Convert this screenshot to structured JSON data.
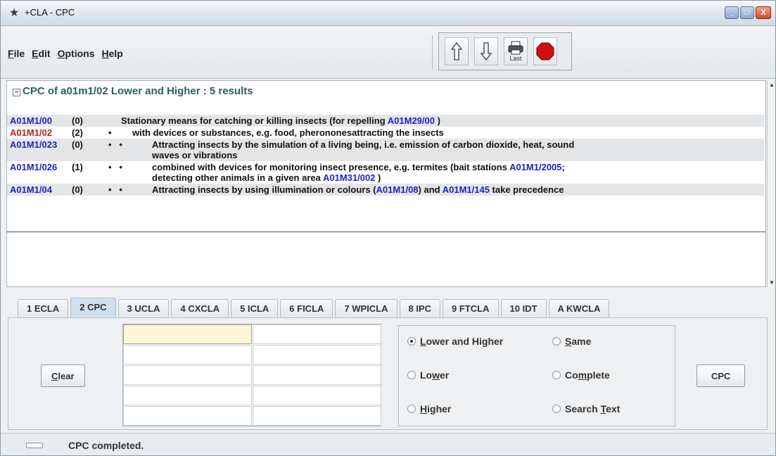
{
  "window": {
    "title": "+CLA - CPC",
    "controls": {
      "minimize": "_",
      "maximize": "□",
      "close": "X"
    }
  },
  "menu": [
    {
      "label": "File",
      "mnemonic": "F",
      "rest": "ile"
    },
    {
      "label": "Edit",
      "mnemonic": "E",
      "rest": "dit"
    },
    {
      "label": "Options",
      "mnemonic": "O",
      "rest": "ptions"
    },
    {
      "label": "Help",
      "mnemonic": "H",
      "rest": "elp"
    }
  ],
  "toolbar": {
    "up_icon": "up-arrow-icon",
    "down_icon": "down-arrow-icon",
    "last_label": "Last",
    "stop_icon": "stop-icon",
    "stop_color": "#d01010"
  },
  "results": {
    "collapse_glyph": "−",
    "header": "CPC of a01m1/02 Lower and Higher : 5 results",
    "rows": [
      {
        "code": "A01M1/00",
        "count": "(0)",
        "dots": "",
        "selected": false,
        "text1": "Stationary means for catching or killing insects  (for repelling ",
        "link1": "A01M29/00",
        "text2": " )",
        "link2": "",
        "text3": "",
        "text_line2": "",
        "link_line2": "",
        "text_line2_end": ""
      },
      {
        "code": "A01M1/02",
        "count": "(2)",
        "dots": "•",
        "selected": true,
        "text1": "with devices or substances, e.g. food, pherononesattracting the insects",
        "link1": "",
        "text2": "",
        "link2": "",
        "text3": "",
        "text_line2": "",
        "link_line2": "",
        "text_line2_end": ""
      },
      {
        "code": "A01M1/023",
        "count": "(0)",
        "dots": "•   •",
        "selected": false,
        "text1": "Attracting insects by the simulation of a living being, i.e. emission of carbon dioxide, heat, sound",
        "link1": "",
        "text2": "",
        "link2": "",
        "text3": "",
        "text_line2": "waves or vibrations",
        "link_line2": "",
        "text_line2_end": ""
      },
      {
        "code": "A01M1/026",
        "count": "(1)",
        "dots": "•   •",
        "selected": false,
        "text1": "combined with devices for monitoring insect presence, e.g. termites  (bait stations ",
        "link1": "A01M1/2005",
        "text2": ";",
        "link2": "",
        "text3": "",
        "text_line2": "detecting other animals in a given area ",
        "link_line2": "A01M31/002",
        "text_line2_end": " )"
      },
      {
        "code": "A01M1/04",
        "count": "(0)",
        "dots": "•   •",
        "selected": false,
        "text1": "Attracting insects by using illumination or colours  (",
        "link1": "A01M1/08",
        "text2": ") and ",
        "link2": "A01M1/145",
        "text3": " take precedence",
        "text_line2": "",
        "link_line2": "",
        "text_line2_end": ""
      }
    ],
    "link_color": "#1d23c4",
    "selected_color": "#c02020"
  },
  "tabs": [
    {
      "label": "1 ECLA",
      "active": false
    },
    {
      "label": "2 CPC",
      "active": true
    },
    {
      "label": "3 UCLA",
      "active": false
    },
    {
      "label": "4 CXCLA",
      "active": false
    },
    {
      "label": "5 ICLA",
      "active": false
    },
    {
      "label": "6 FICLA",
      "active": false
    },
    {
      "label": "7 WPICLA",
      "active": false
    },
    {
      "label": "8 IPC",
      "active": false
    },
    {
      "label": "9 FTCLA",
      "active": false
    },
    {
      "label": "10 IDT",
      "active": false
    },
    {
      "label": "A KWCLA",
      "active": false
    }
  ],
  "panel": {
    "clear_mnemonic": "C",
    "clear_rest": "lear",
    "grid_values": [
      "",
      "",
      "",
      "",
      "",
      "",
      "",
      "",
      "",
      ""
    ],
    "options": [
      {
        "pre": "",
        "mn": "L",
        "post": "ower and Higher",
        "checked": true
      },
      {
        "pre": "",
        "mn": "S",
        "post": "ame",
        "checked": false
      },
      {
        "pre": "Lo",
        "mn": "w",
        "post": "er",
        "checked": false
      },
      {
        "pre": "Co",
        "mn": "m",
        "post": "plete",
        "checked": false
      },
      {
        "pre": "",
        "mn": "H",
        "post": "igher",
        "checked": false
      },
      {
        "pre": "Search ",
        "mn": "T",
        "post": "ext",
        "checked": false
      }
    ],
    "cpc_button": "CPC"
  },
  "status": {
    "text": "CPC completed."
  }
}
